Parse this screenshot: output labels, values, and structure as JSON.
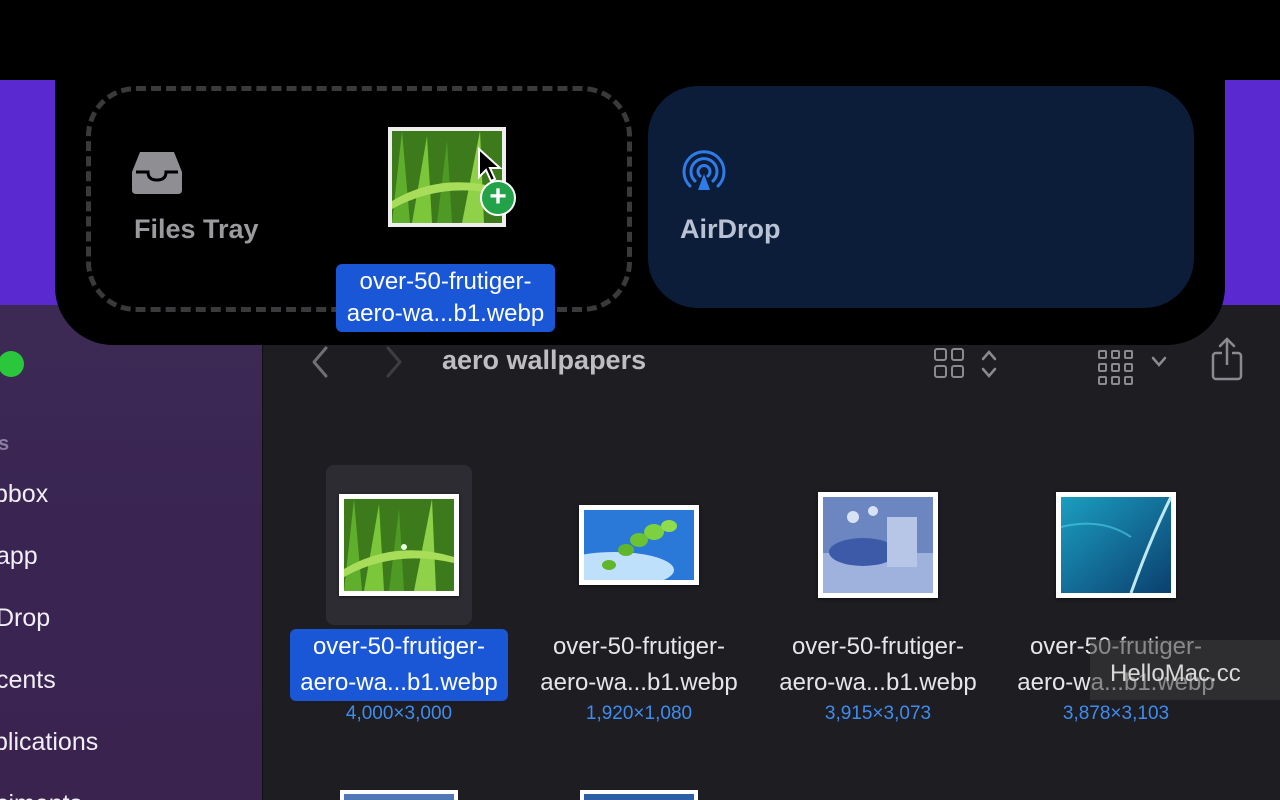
{
  "shelf": {
    "files_tray_label": "Files Tray",
    "airdrop_label": "AirDrop",
    "dragged_file_label": "over-50-frutiger-aero-wa...b1.webp"
  },
  "finder": {
    "folder_title": "aero wallpapers",
    "sidebar": {
      "section_label": "s",
      "items": [
        {
          "label": "pbox"
        },
        {
          "label": "app"
        },
        {
          "label": "Drop"
        },
        {
          "label": "cents"
        },
        {
          "label": "plications"
        },
        {
          "label": "ciments"
        }
      ]
    },
    "files": [
      {
        "name_line1": "over-50-frutiger-",
        "name_line2": "aero-wa...b1.webp",
        "dims": "4,000×3,000",
        "selected": true
      },
      {
        "name_line1": "over-50-frutiger-",
        "name_line2": "aero-wa...b1.webp",
        "dims": "1,920×1,080",
        "selected": false
      },
      {
        "name_line1": "over-50-frutiger-",
        "name_line2": "aero-wa...b1.webp",
        "dims": "3,915×3,073",
        "selected": false
      },
      {
        "name_line1": "over-50-frutiger-",
        "name_line2": "aero-wa...b1.webp",
        "dims": "3,878×3,103",
        "selected": false
      }
    ]
  },
  "watermark": "HelloMac.cc",
  "colors": {
    "selection": "#1a57d6",
    "dims_text": "#3e8cf0",
    "add_badge": "#22a34a"
  },
  "icons": [
    "tray-icon",
    "airdrop-icon",
    "add-plus-icon",
    "cursor-icon",
    "back-chevron-icon",
    "forward-chevron-icon",
    "icon-view-icon",
    "group-by-icon",
    "share-icon"
  ]
}
